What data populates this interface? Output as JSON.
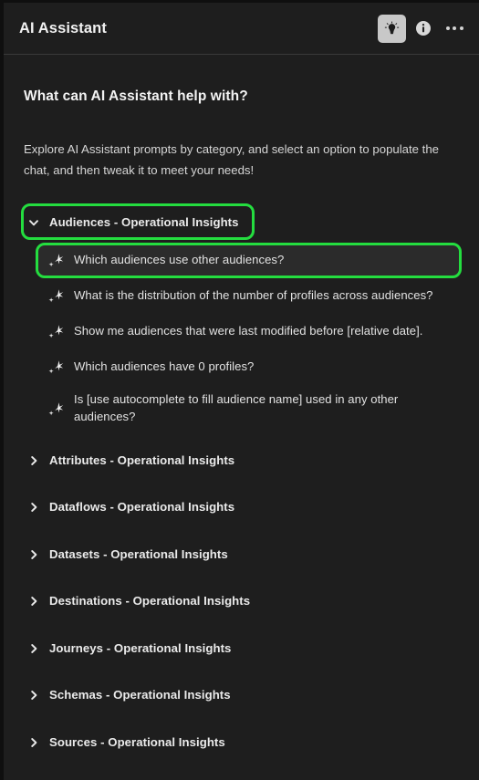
{
  "header": {
    "title": "AI Assistant",
    "actions": [
      {
        "name": "lightbulb-icon",
        "label": "Prompt library",
        "selected": true
      },
      {
        "name": "info-icon",
        "label": "Information",
        "selected": false
      },
      {
        "name": "more-options-icon",
        "label": "More options",
        "selected": false
      }
    ]
  },
  "intro": {
    "title": "What can AI Assistant help with?",
    "description": "Explore AI Assistant prompts by category, and select an option to populate the chat, and then tweak it to meet your needs!"
  },
  "colors": {
    "highlight_green": "#24dd3f",
    "panel_background": "#1e1e1e",
    "header_background": "#1e1e1e",
    "prompt_highlight_background": "#2b2b2b"
  },
  "categories": [
    {
      "label": "Audiences - Operational Insights",
      "expanded": true,
      "highlighted": true,
      "chevron": "chevron-down-icon",
      "prompts": [
        {
          "label": "Which audiences use other audiences?",
          "highlighted": true
        },
        {
          "label": "What is the distribution of the number of profiles across audiences?",
          "highlighted": false
        },
        {
          "label": "Show me audiences that were last modified before [relative date].",
          "highlighted": false
        },
        {
          "label": "Which audiences have 0 profiles?",
          "highlighted": false
        },
        {
          "label": "Is [use autocomplete to fill audience name] used in any other audiences?",
          "highlighted": false
        }
      ]
    },
    {
      "label": "Attributes - Operational Insights",
      "expanded": false,
      "highlighted": false,
      "chevron": "chevron-right-icon",
      "prompts": []
    },
    {
      "label": "Dataflows - Operational Insights",
      "expanded": false,
      "highlighted": false,
      "chevron": "chevron-right-icon",
      "prompts": []
    },
    {
      "label": "Datasets - Operational Insights",
      "expanded": false,
      "highlighted": false,
      "chevron": "chevron-right-icon",
      "prompts": []
    },
    {
      "label": "Destinations - Operational Insights",
      "expanded": false,
      "highlighted": false,
      "chevron": "chevron-right-icon",
      "prompts": []
    },
    {
      "label": "Journeys - Operational Insights",
      "expanded": false,
      "highlighted": false,
      "chevron": "chevron-right-icon",
      "prompts": []
    },
    {
      "label": "Schemas - Operational Insights",
      "expanded": false,
      "highlighted": false,
      "chevron": "chevron-right-icon",
      "prompts": []
    },
    {
      "label": "Sources - Operational Insights",
      "expanded": false,
      "highlighted": false,
      "chevron": "chevron-right-icon",
      "prompts": []
    }
  ]
}
